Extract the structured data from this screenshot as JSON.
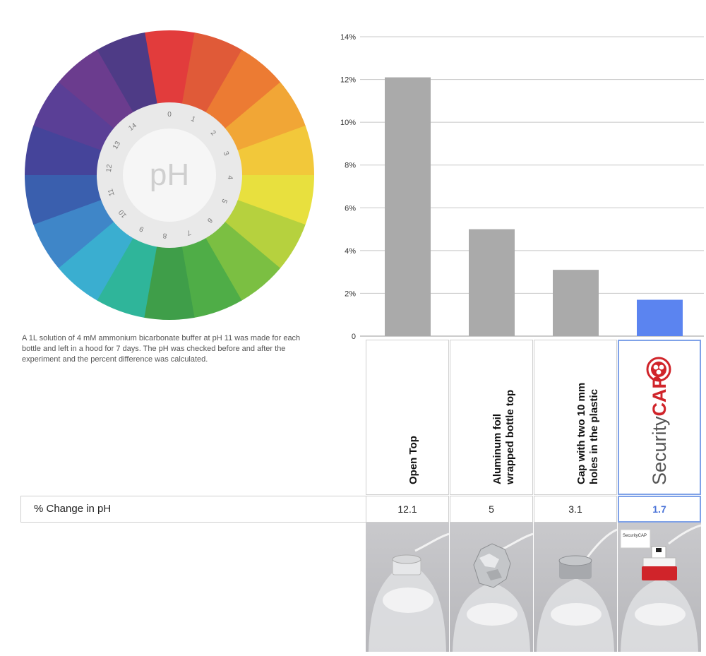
{
  "wheel": {
    "center_label": "pH",
    "numbers": [
      "0",
      "1",
      "2",
      "3",
      "4",
      "5",
      "6",
      "7",
      "8",
      "9",
      "10",
      "11",
      "12",
      "13",
      "14"
    ],
    "colors": [
      "#e23c3c",
      "#e05a38",
      "#ec7b33",
      "#f1a636",
      "#f2c83a",
      "#e8e03e",
      "#b6d13e",
      "#7bbf42",
      "#4fad47",
      "#3f9e49",
      "#2fb59a",
      "#3aaed0",
      "#3f86c8",
      "#3a5fae",
      "#45449a",
      "#5a3f96",
      "#6b3c8e",
      "#4e3b86"
    ]
  },
  "description": "A 1L solution of 4 mM ammonium bicarbonate buffer at pH 11 was made for each bottle and left in a hood for 7 days. The pH was checked before and after the experiment and the percent difference was calculated.",
  "chart_data": {
    "type": "bar",
    "categories": [
      "Open Top",
      "Aluminum foil\nwrapped bottle top",
      "Cap with two 10 mm\nholes in the plastic",
      "SecurityCAP"
    ],
    "values": [
      12.1,
      5,
      3.1,
      1.7
    ],
    "yticks": [
      "0",
      "2%",
      "4%",
      "6%",
      "8%",
      "10%",
      "12%",
      "14%"
    ],
    "ylim": [
      0,
      14
    ],
    "grid": true,
    "bar_colors": [
      "#aaaaaa",
      "#aaaaaa",
      "#aaaaaa",
      "#5b84f0"
    ]
  },
  "table": {
    "row_label": "% Change in pH",
    "values": [
      "12.1",
      "5",
      "3.1",
      "1.7"
    ]
  },
  "brand": {
    "name_prefix": "Security",
    "name_suffix": "CAP",
    "color": "#d0242a"
  },
  "photo_label_text": "SecurityCAP"
}
